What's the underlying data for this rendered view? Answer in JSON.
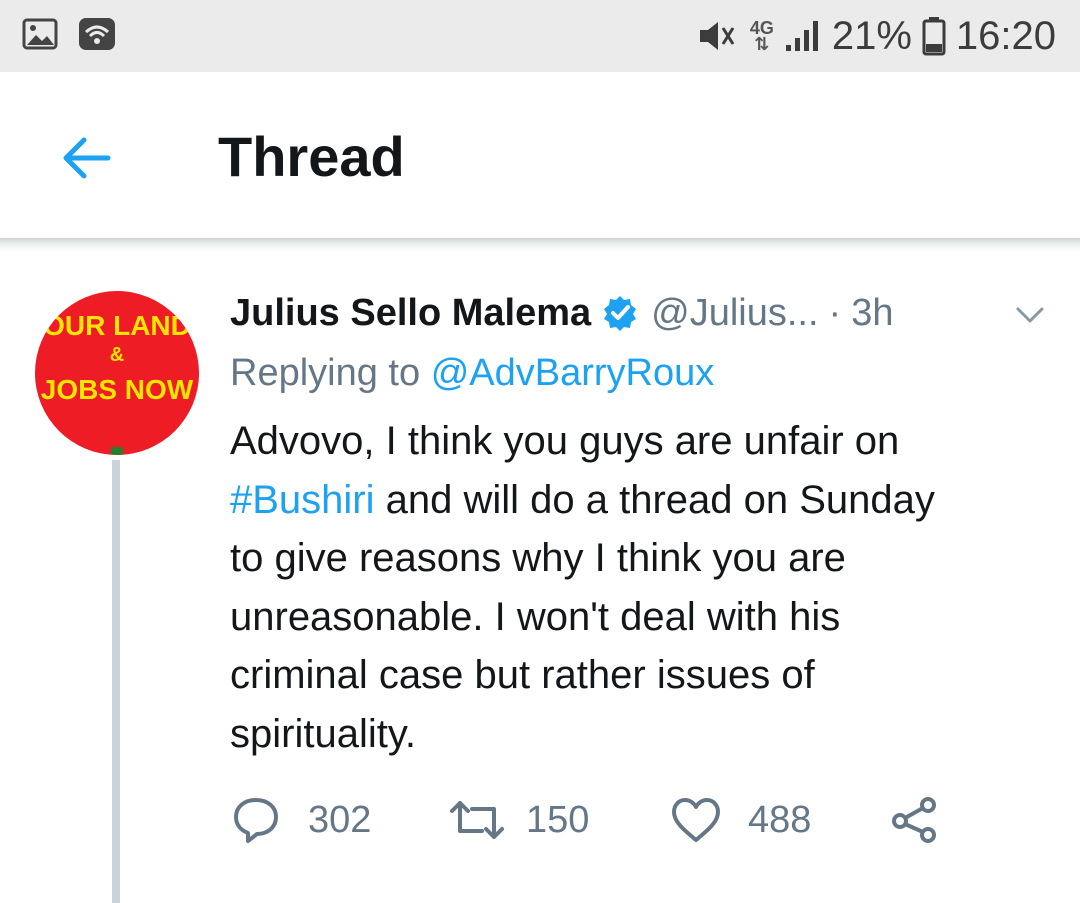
{
  "status_bar": {
    "icons_left": [
      "image-icon",
      "wifi-icon"
    ],
    "icons_right": [
      "mute-icon",
      "network-4g-icon",
      "signal-icon",
      "battery-icon"
    ],
    "network": "4G",
    "battery": "21%",
    "time": "16:20"
  },
  "header": {
    "back_icon": "arrow-left-icon",
    "title": "Thread",
    "accent_color": "#1da1f2"
  },
  "tweet": {
    "avatar": {
      "line1": "OUR LAND",
      "amp": "&",
      "line2": "JOBS NOW",
      "bg_color": "#ee1c25",
      "text_color": "#ffe600"
    },
    "author_name": "Julius Sello Malema",
    "verified": true,
    "handle": "@Julius...",
    "separator": "·",
    "time_ago": "3h",
    "replying_prefix": "Replying to",
    "replying_to": "@AdvBarryRoux",
    "body_lines": [
      "Advovo, I think you guys are unfair on",
      "and will do a thread on Sunday",
      "to give reasons why I think you are",
      "unreasonable. I won't deal with his",
      "criminal case but rather issues of",
      "spirituality."
    ],
    "hashtag": "#Bushiri",
    "actions": {
      "replies": "302",
      "retweets": "150",
      "likes": "488"
    }
  }
}
